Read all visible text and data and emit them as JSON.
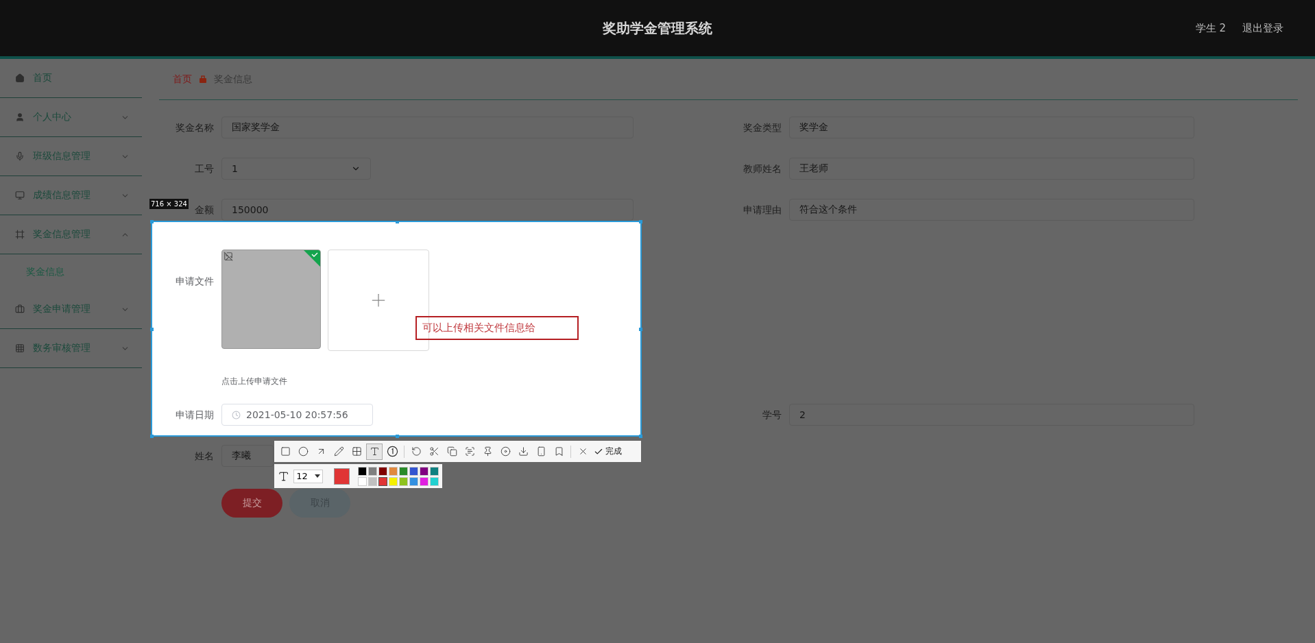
{
  "header": {
    "title": "奖助学金管理系统",
    "user": "学生 2",
    "logout": "退出登录"
  },
  "sidebar": {
    "items": [
      {
        "label": "首页"
      },
      {
        "label": "个人中心",
        "expanded": false
      },
      {
        "label": "班级信息管理",
        "expanded": false
      },
      {
        "label": "成绩信息管理",
        "expanded": false
      },
      {
        "label": "奖金信息管理",
        "expanded": true,
        "children": [
          {
            "label": "奖金信息",
            "selected": true
          }
        ]
      },
      {
        "label": "奖金申请管理",
        "expanded": false
      },
      {
        "label": "数务审核管理",
        "expanded": false
      }
    ]
  },
  "breadcrumb": [
    "首页",
    "奖金信息"
  ],
  "form": {
    "rows": [
      {
        "fields": [
          {
            "kind": "text",
            "label": "奖金名称",
            "value": "国家奖学金",
            "in_selection": false
          },
          {
            "kind": "text",
            "label": "奖金类型",
            "value": "奖学金",
            "in_selection": false
          }
        ]
      },
      {
        "fields": [
          {
            "kind": "select",
            "label": "工号",
            "value": "1",
            "in_selection": false
          },
          {
            "kind": "text",
            "label": "教师姓名",
            "value": "王老师",
            "in_selection": false
          }
        ]
      },
      {
        "fields": [
          {
            "kind": "text",
            "label": "金额",
            "value": "150000",
            "in_selection": false
          },
          {
            "kind": "text",
            "label": "申请理由",
            "value": "符合这个条件",
            "in_selection": false
          }
        ]
      },
      {
        "fields": [
          {
            "kind": "upload",
            "label": "申请文件",
            "hint": "点击上传申请文件",
            "files": [
              {
                "uploaded": true
              }
            ],
            "in_selection": true
          }
        ]
      },
      {
        "fields": [
          {
            "kind": "date",
            "label": "申请日期",
            "value": "2021-05-10 20:57:56",
            "in_selection": true
          },
          {
            "kind": "text",
            "label": "学号",
            "value": "2",
            "in_selection": false
          }
        ]
      },
      {
        "fields": [
          {
            "kind": "text",
            "label": "姓名",
            "value": "李曦",
            "in_selection": false
          }
        ]
      }
    ],
    "buttons": [
      {
        "kind": "primary",
        "label": "提交"
      },
      {
        "kind": "secondary",
        "label": "取消"
      }
    ]
  },
  "capture": {
    "size": "716 × 324",
    "annotation": "可以上传相关文件信息给",
    "tools": [
      {
        "kind": "rectangle",
        "selected": false
      },
      {
        "kind": "ellipse",
        "selected": false
      },
      {
        "kind": "arrow",
        "selected": false
      },
      {
        "kind": "pencil",
        "selected": false
      },
      {
        "kind": "mosaic",
        "selected": false
      },
      {
        "kind": "text",
        "selected": true
      },
      {
        "kind": "number",
        "selected": false
      },
      {
        "kind": "divider"
      },
      {
        "kind": "undo",
        "selected": false
      },
      {
        "kind": "cut",
        "selected": false
      },
      {
        "kind": "copy",
        "selected": false
      },
      {
        "kind": "scan",
        "selected": false
      },
      {
        "kind": "pin",
        "selected": false
      },
      {
        "kind": "record",
        "selected": false
      },
      {
        "kind": "download",
        "selected": false
      },
      {
        "kind": "phone",
        "selected": false
      },
      {
        "kind": "bookmark",
        "selected": false
      },
      {
        "kind": "divider"
      },
      {
        "kind": "close",
        "selected": false
      }
    ],
    "done": "完成",
    "font_size": "12",
    "swatches": [
      {
        "color": "#000000",
        "selected": false
      },
      {
        "color": "#7f7f7f",
        "selected": false
      },
      {
        "color": "#800000",
        "selected": false
      },
      {
        "color": "#e0893f",
        "selected": false
      },
      {
        "color": "#2a8a2a",
        "selected": false
      },
      {
        "color": "#3355d0",
        "selected": false
      },
      {
        "color": "#800080",
        "selected": false
      },
      {
        "color": "#108080",
        "selected": false
      },
      {
        "color": "#ffffff",
        "selected": false
      },
      {
        "color": "#c0c0c0",
        "selected": false
      },
      {
        "color": "#e03535",
        "selected": true
      },
      {
        "color": "#f5f000",
        "selected": false
      },
      {
        "color": "#8ec21e",
        "selected": false
      },
      {
        "color": "#3390e0",
        "selected": false
      },
      {
        "color": "#e020e0",
        "selected": false
      },
      {
        "color": "#22d0d0",
        "selected": false
      }
    ]
  }
}
